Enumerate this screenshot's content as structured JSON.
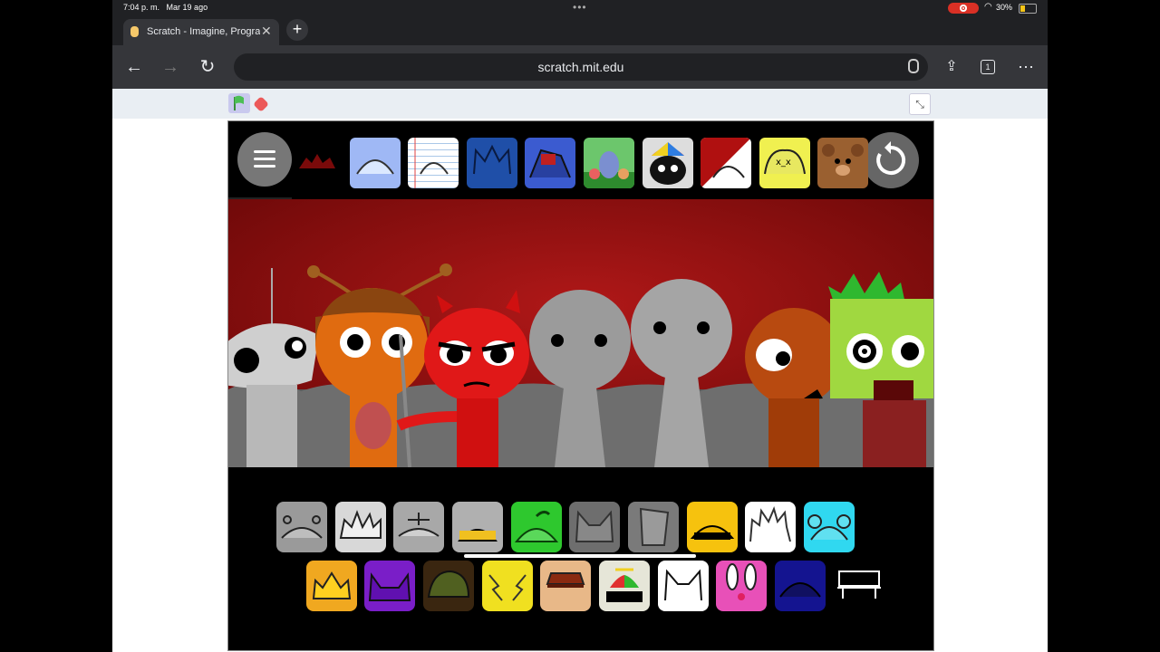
{
  "status_bar": {
    "time": "7:04 p. m.",
    "date": "Mar 19 ago",
    "battery": "30%"
  },
  "tab": {
    "title": "Scratch - Imagine, Program, Share"
  },
  "toolbar": {
    "url": "scratch.mit.edu",
    "tab_count": "1"
  },
  "top_tiles": [
    "blue-ghost-head",
    "notebook-paper-head",
    "blue-crown-head",
    "blue-red-head",
    "green-monster-image",
    "cat-with-cap-image",
    "red-white-split-head",
    "yellow-frog-head",
    "brown-bear-head"
  ],
  "bottom_row_1": [
    "gray-antenna-head",
    "white-spiky-head",
    "gray-plate-head",
    "black-yellow-band-head",
    "green-apple-head",
    "gray-cat-ears-head",
    "gray-bucket-head",
    "yellow-band-head",
    "white-spiky-hair-head",
    "cyan-ears-head"
  ],
  "bottom_row_2": [
    "yellow-crown-head",
    "purple-horns-head",
    "dark-green-hair-head",
    "yellow-lightning-head",
    "tan-hat-head",
    "propeller-cap-head",
    "white-cat-ears-head",
    "pink-bunny-ears-head",
    "navy-dome-head",
    "bench-outline"
  ],
  "colors": {
    "stage_bg": "#000000",
    "scene_red": "#8a0e0e",
    "accent_gray": "#777777"
  }
}
